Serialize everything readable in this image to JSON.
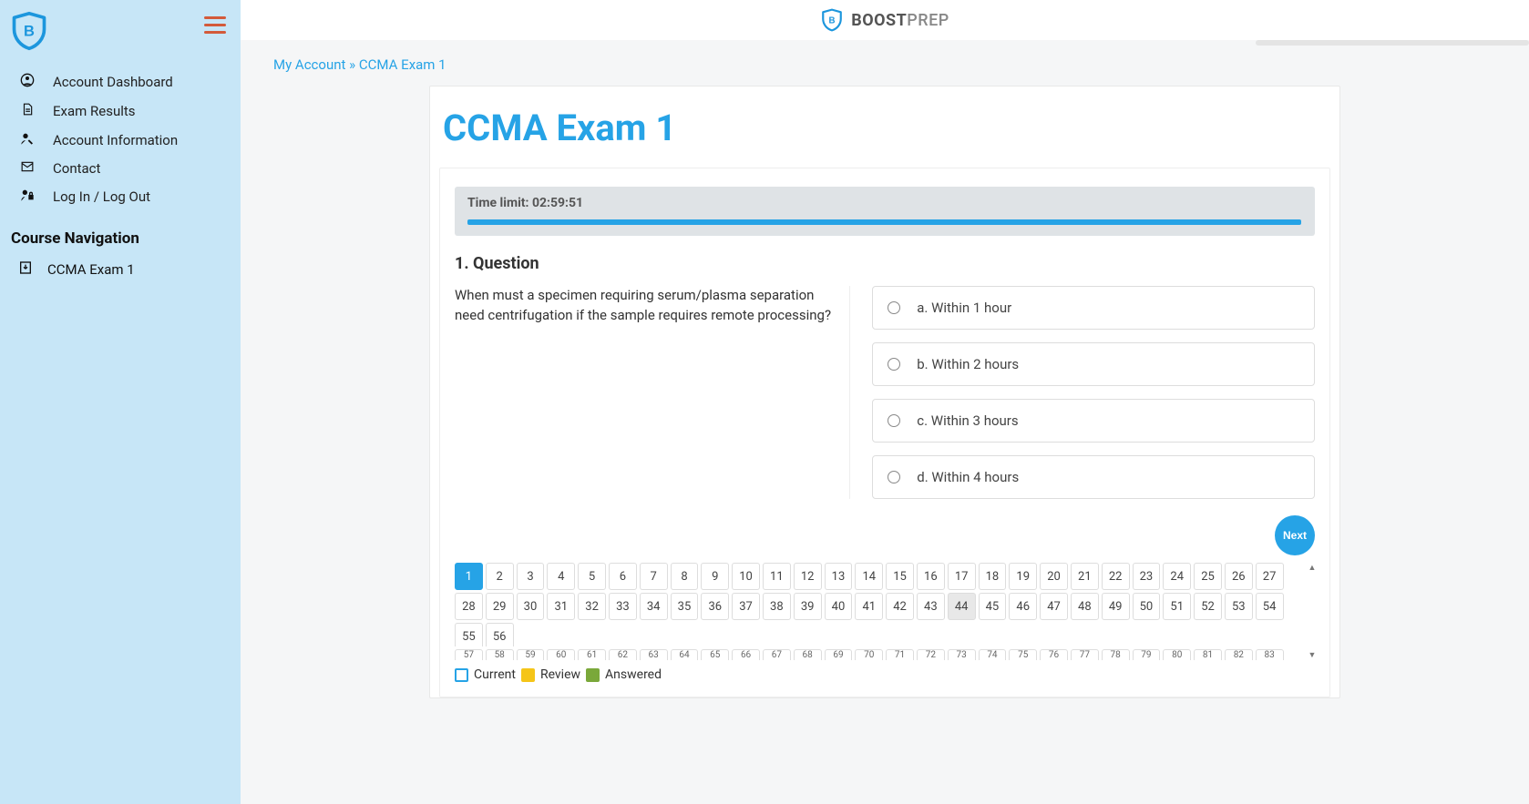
{
  "brand": {
    "bold": "BOOST",
    "light": "PREP"
  },
  "sidebar": {
    "nav": [
      {
        "label": "Account Dashboard",
        "icon": "user-circle-icon"
      },
      {
        "label": "Exam Results",
        "icon": "file-icon"
      },
      {
        "label": "Account Information",
        "icon": "user-edit-icon"
      },
      {
        "label": "Contact",
        "icon": "mail-icon"
      },
      {
        "label": "Log In / Log Out",
        "icon": "lock-icon"
      }
    ],
    "course_heading": "Course Navigation",
    "courses": [
      {
        "label": "CCMA Exam 1",
        "icon": "download-icon"
      }
    ]
  },
  "breadcrumb": {
    "a": "My Account",
    "sep": " » ",
    "b": "CCMA Exam 1"
  },
  "exam": {
    "title": "CCMA Exam 1",
    "timer_label": "Time limit: 02:59:51",
    "timer_percent": 99.9,
    "q_number": "1.",
    "q_word": "Question",
    "q_text": "When must a specimen requiring serum/plasma separation need centrifugation if the sample requires remote processing?",
    "options": [
      {
        "prefix": "a.",
        "label": "Within 1 hour"
      },
      {
        "prefix": "b.",
        "label": "Within 2 hours"
      },
      {
        "prefix": "c.",
        "label": "Within 3 hours"
      },
      {
        "prefix": "d.",
        "label": "Within 4 hours"
      }
    ],
    "next_label": "Next",
    "page_count": 84,
    "current_page": 1,
    "shaded_page": 44,
    "legend": {
      "current": "Current",
      "review": "Review",
      "answered": "Answered"
    }
  }
}
